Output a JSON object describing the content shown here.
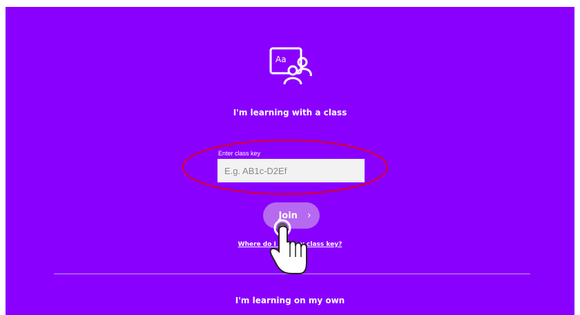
{
  "colors": {
    "background": "#8a00ff",
    "join_button": "#b56af0",
    "highlight": "#e0001b"
  },
  "icons": {
    "class": "classroom-icon",
    "join": "chevron-right-icon",
    "pointer": "hand-pointer-icon"
  },
  "class_section": {
    "heading": "I'm learning with a class",
    "key_label": "Enter class key",
    "key_placeholder": "E.g. AB1c-D2Ef",
    "key_value": "",
    "join_label": "Join",
    "help_link": "Where do I find my class key?"
  },
  "own_section": {
    "heading": "I'm learning on my own"
  }
}
